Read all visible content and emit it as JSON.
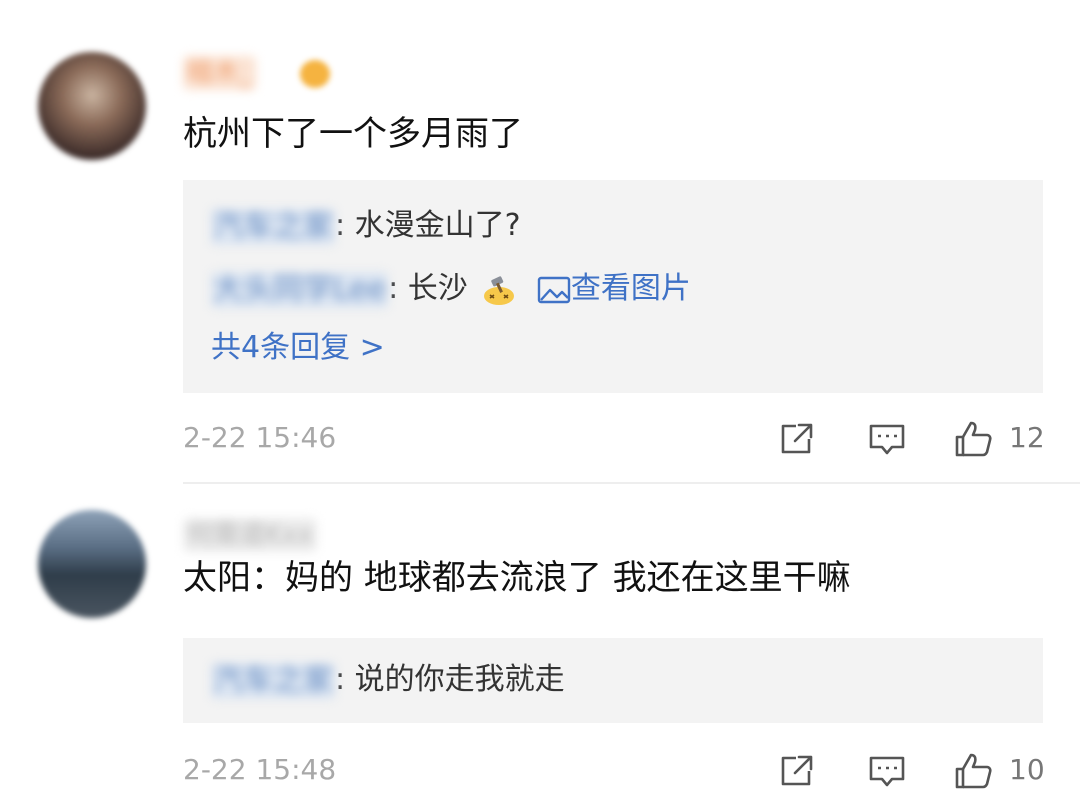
{
  "comments": [
    {
      "username": "暗木_",
      "text": "杭州下了一个多月雨了",
      "replies": [
        {
          "user": "汽车之家",
          "colon": ":",
          "text": "水漫金山了?"
        },
        {
          "user": "大头同学Lee",
          "colon": ":",
          "text": "长沙",
          "emoji": "gavel-emoji",
          "link": "查看图片",
          "link_icon": "image-icon"
        }
      ],
      "more_replies": "共4条回复 >",
      "timestamp": "2-22 15:46",
      "likes": "12"
    },
    {
      "username": "何需道Kxx",
      "text": "太阳：妈的 地球都去流浪了 我还在这里干嘛",
      "replies": [
        {
          "user": "汽车之家",
          "colon": ":",
          "text": "说的你走我就走"
        }
      ],
      "timestamp": "2-22 15:48",
      "likes": "10"
    }
  ],
  "icons": {
    "share": "share-icon",
    "reply": "comment-icon",
    "like": "thumbs-up-icon"
  },
  "colors": {
    "link": "#3f72c6",
    "reply_bg": "#f3f3f3",
    "meta": "#a8a8a8"
  }
}
